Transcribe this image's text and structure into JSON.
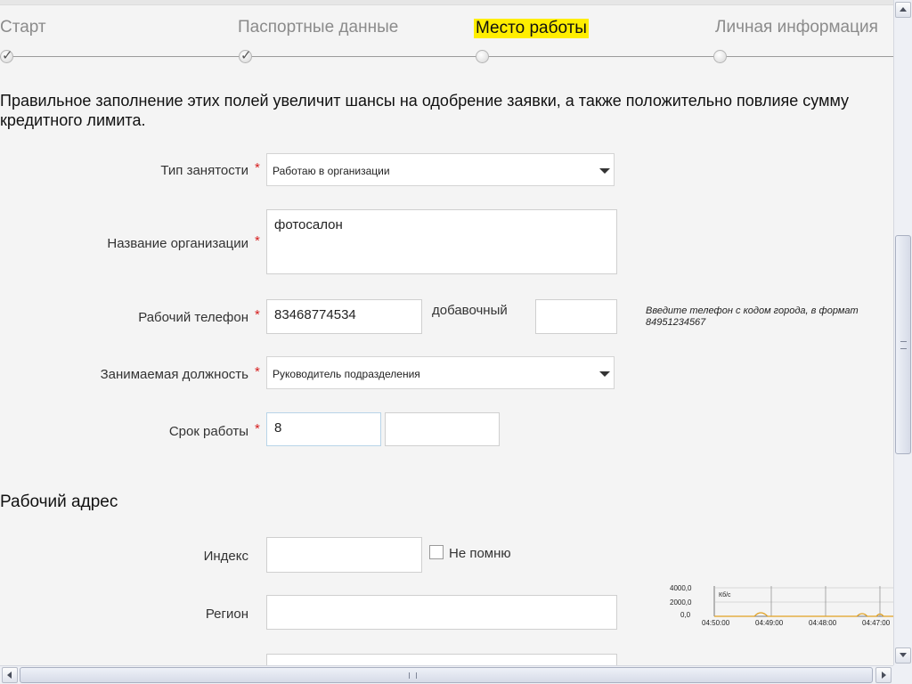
{
  "steps": [
    {
      "label": "Старт",
      "done": true
    },
    {
      "label": "Паспортные данные",
      "done": true
    },
    {
      "label": "Место работы",
      "done": false,
      "active": true
    },
    {
      "label": "Личная информация",
      "done": false
    }
  ],
  "intro_text": "Правильное заполнение этих полей увеличит шансы на одобрение заявки, а также положительно повлияе сумму кредитного лимита.",
  "form": {
    "required_mark": "*",
    "employment_type": {
      "label": "Тип занятости",
      "value": "Работаю в организации"
    },
    "org_name": {
      "label": "Название организации",
      "value": "фотосалон"
    },
    "work_phone": {
      "label": "Рабочий телефон",
      "value": "83468774534",
      "ext_label": "добавочный",
      "ext_value": ""
    },
    "phone_hint": "Введите телефон с кодом города, в формат 84951234567",
    "position": {
      "label": "Занимаемая должность",
      "value": "Руководитель подразделения"
    },
    "work_term": {
      "label": "Срок работы",
      "value": "8",
      "value2": ""
    }
  },
  "address": {
    "title": "Рабочий адрес",
    "index": {
      "label": "Индекс",
      "value": ""
    },
    "dont_remember": "Не помню",
    "region": {
      "label": "Регион",
      "value": ""
    }
  },
  "chart_data": {
    "type": "line",
    "unit_label": "Кб/с",
    "y_ticks": [
      "4000,0",
      "2000,0",
      "0,0"
    ],
    "x_ticks": [
      "04:50:00",
      "04:49:00",
      "04:48:00",
      "04:47:00"
    ],
    "colors": {
      "series": "#e0a020",
      "grid": "#777777"
    }
  }
}
